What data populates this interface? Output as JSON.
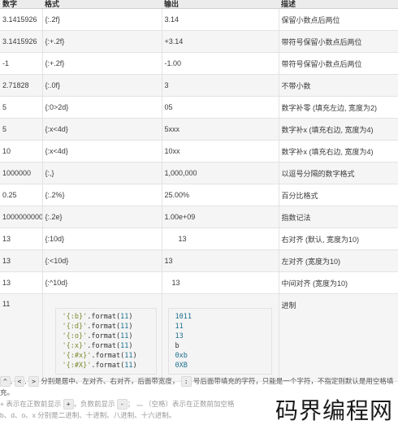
{
  "table": {
    "headers": [
      "数字",
      "格式",
      "输出",
      "描述"
    ],
    "rows": [
      [
        "3.1415926",
        "{:.2f}",
        "3.14",
        "保留小数点后两位"
      ],
      [
        "3.1415926",
        "{:+.2f}",
        "+3.14",
        "带符号保留小数点后两位"
      ],
      [
        "-1",
        "{:+.2f}",
        "-1.00",
        "带符号保留小数点后两位"
      ],
      [
        "2.71828",
        "{:.0f}",
        "3",
        "不带小数"
      ],
      [
        "5",
        "{:0>2d}",
        "05",
        "数字补零 (填充左边, 宽度为2)"
      ],
      [
        "5",
        "{:x<4d}",
        "5xxx",
        "数字补x (填充右边, 宽度为4)"
      ],
      [
        "10",
        "{:x<4d}",
        "10xx",
        "数字补x (填充右边, 宽度为4)"
      ],
      [
        "1000000",
        "{:,}",
        "1,000,000",
        "以逗号分隔的数字格式"
      ],
      [
        "0.25",
        "{:.2%}",
        "25.00%",
        "百分比格式"
      ],
      [
        "1000000000",
        "{:.2e}",
        "1.00e+09",
        "指数记法"
      ],
      [
        "13",
        "{:10d}",
        "13",
        "右对齐 (默认, 宽度为10)"
      ],
      [
        "13",
        "{:<10d}",
        "13",
        "左对齐 (宽度为10)"
      ],
      [
        "13",
        "{:^10d}",
        "13",
        "中间对齐 (宽度为10)"
      ]
    ],
    "code_row": {
      "number": "11",
      "description": "进制",
      "code_lines": [
        {
          "fmt": "'{:b}'",
          "call": ".format(",
          "arg": "11",
          "end": ")"
        },
        {
          "fmt": "'{:d}'",
          "call": ".format(",
          "arg": "11",
          "end": ")"
        },
        {
          "fmt": "'{:o}'",
          "call": ".format(",
          "arg": "11",
          "end": ")"
        },
        {
          "fmt": "'{:x}'",
          "call": ".format(",
          "arg": "11",
          "end": ")"
        },
        {
          "fmt": "'{:#x}'",
          "call": ".format(",
          "arg": "11",
          "end": ")"
        },
        {
          "fmt": "'{:#X}'",
          "call": ".format(",
          "arg": "11",
          "end": ")"
        }
      ],
      "output_lines": [
        "1011",
        "11",
        "13",
        "b",
        "0xb",
        "0XB"
      ]
    }
  },
  "notes": {
    "line1_chips": [
      "^",
      "<",
      ">"
    ],
    "line1_a": "分别是居中、左对齐、右对齐，后面带宽度，",
    "line1_chip2": ":",
    "line1_b": "号后面带填充的字符，只能是一个字符，不指定则默认是用空格填",
    "line1_cont": "充。",
    "line2_a": "+ 表示在正数前显示",
    "line2_chip1": "+",
    "line2_b": "，负数前显示",
    "line2_chip2": "-",
    "line2_c": "；",
    "line2_chip3": " ",
    "line2_d": "（空格）表示在正数前加空格",
    "line3": "b、d、o、x 分别是二进制、十进制、八进制、十六进制。"
  },
  "watermark": "码界编程网"
}
